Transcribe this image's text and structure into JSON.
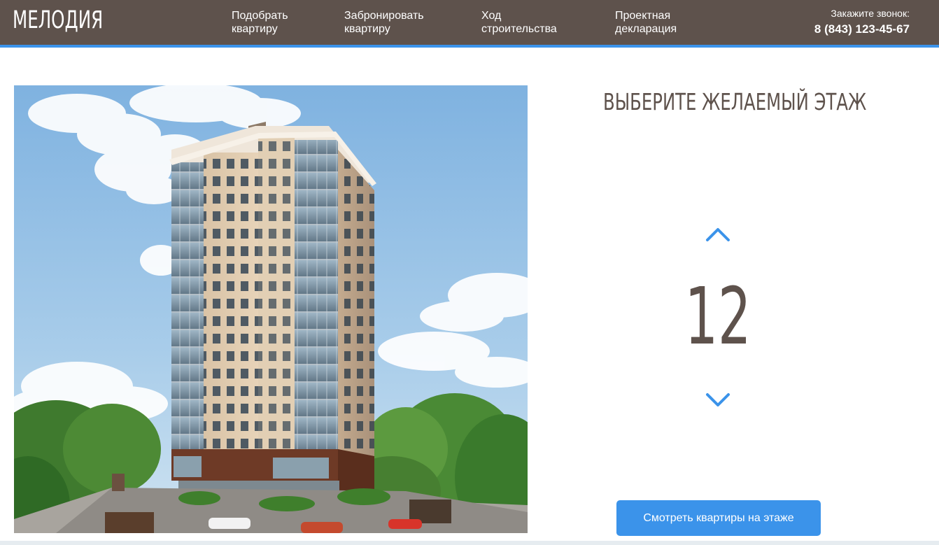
{
  "header": {
    "logo": "МЕЛОДИЯ",
    "nav": [
      {
        "line1": "Подобрать",
        "line2": "квартиру"
      },
      {
        "line1": "Забронировать",
        "line2": "квартиру"
      },
      {
        "line1": "Ход",
        "line2": "строительства"
      },
      {
        "line1": "Проектная",
        "line2": "декларация"
      }
    ],
    "callback_label": "Закажите звонок:",
    "phone": "8 (843) 123-45-67"
  },
  "floor_selector": {
    "title": "ВЫБЕРИТЕ ЖЕЛАЕМЫЙ ЭТАЖ",
    "current_floor": "12",
    "up_icon": "chevron-up-icon",
    "down_icon": "chevron-down-icon",
    "button_label": "Смотреть квартиры на этаже"
  },
  "colors": {
    "header_bg": "#5e524c",
    "accent": "#3b93ea",
    "text_brown": "#5e524c"
  }
}
